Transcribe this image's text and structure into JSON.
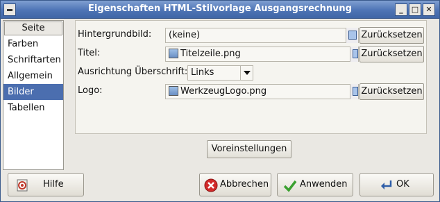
{
  "window": {
    "title": "Eigenschaften HTML-Stilvorlage Ausgangsrechnung",
    "minimize_glyph": "_",
    "maximize_glyph": "□",
    "close_glyph": "✕"
  },
  "sidebar": {
    "header": "Seite",
    "items": [
      {
        "label": "Farben"
      },
      {
        "label": "Schriftarten"
      },
      {
        "label": "Allgemein"
      },
      {
        "label": "Bilder",
        "selected": true
      },
      {
        "label": "Tabellen"
      }
    ]
  },
  "form": {
    "background_label": "Hintergrundbild:",
    "background_value": "(keine)",
    "title_label": "Titel:",
    "title_value": "Titelzeile.png",
    "alignment_label": "Ausrichtung Überschrift:",
    "alignment_value": "Links",
    "logo_label": "Logo:",
    "logo_value": "WerkzeugLogo.png",
    "reset_label": "Zurücksetzen",
    "defaults_label": "Voreinstellungen"
  },
  "footer": {
    "help_label": "Hilfe",
    "cancel_label": "Abbrechen",
    "apply_label": "Anwenden",
    "ok_label": "OK"
  },
  "colors": {
    "titlebar": "#4e74b5",
    "selection": "#4b6eaf",
    "background": "#eae8e3"
  }
}
